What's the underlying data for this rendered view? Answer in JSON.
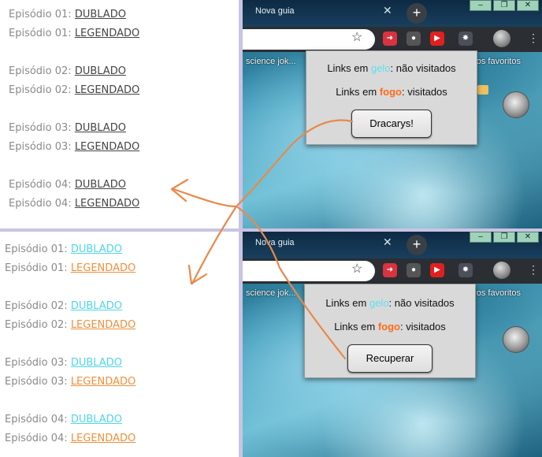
{
  "top_list": [
    {
      "prefix": "Episódio 01: ",
      "link": "DUBLADO"
    },
    {
      "prefix": "Episódio 01: ",
      "link": "LEGENDADO"
    },
    {
      "prefix": "Episódio 02: ",
      "link": "DUBLADO"
    },
    {
      "prefix": "Episódio 02: ",
      "link": "LEGENDADO"
    },
    {
      "prefix": "Episódio 03: ",
      "link": "DUBLADO"
    },
    {
      "prefix": "Episódio 03: ",
      "link": "LEGENDADO"
    },
    {
      "prefix": "Episódio 04: ",
      "link": "DUBLADO"
    },
    {
      "prefix": "Episódio 04: ",
      "link": "LEGENDADO"
    }
  ],
  "bottom_list": [
    {
      "prefix": "Episódio 01: ",
      "link": "DUBLADO"
    },
    {
      "prefix": "Episódio 01: ",
      "link": "LEGENDADO"
    },
    {
      "prefix": "Episódio 02: ",
      "link": "DUBLADO"
    },
    {
      "prefix": "Episódio 02: ",
      "link": "LEGENDADO"
    },
    {
      "prefix": "Episódio 03: ",
      "link": "DUBLADO"
    },
    {
      "prefix": "Episódio 03: ",
      "link": "LEGENDADO"
    },
    {
      "prefix": "Episódio 04: ",
      "link": "DUBLADO"
    },
    {
      "prefix": "Episódio 04: ",
      "link": "LEGENDADO"
    }
  ],
  "browser": {
    "tab_title": "Nova guia",
    "bookmark_left": "science jok...",
    "bookmark_right": "tros favoritos"
  },
  "popup": {
    "line1_pre": "Links em ",
    "line1_kw": "gelo",
    "line1_post": ": não visitados",
    "line2_pre": "Links em ",
    "line2_kw": "fogo",
    "line2_post": ": visitados",
    "button_top": "Dracarys!",
    "button_bottom": "Recuperar"
  },
  "colors": {
    "ice_link": "#4fd6e6",
    "fire_link": "#f08f3a",
    "arrow": "#e8894a",
    "divider": "#c9c4e2"
  }
}
